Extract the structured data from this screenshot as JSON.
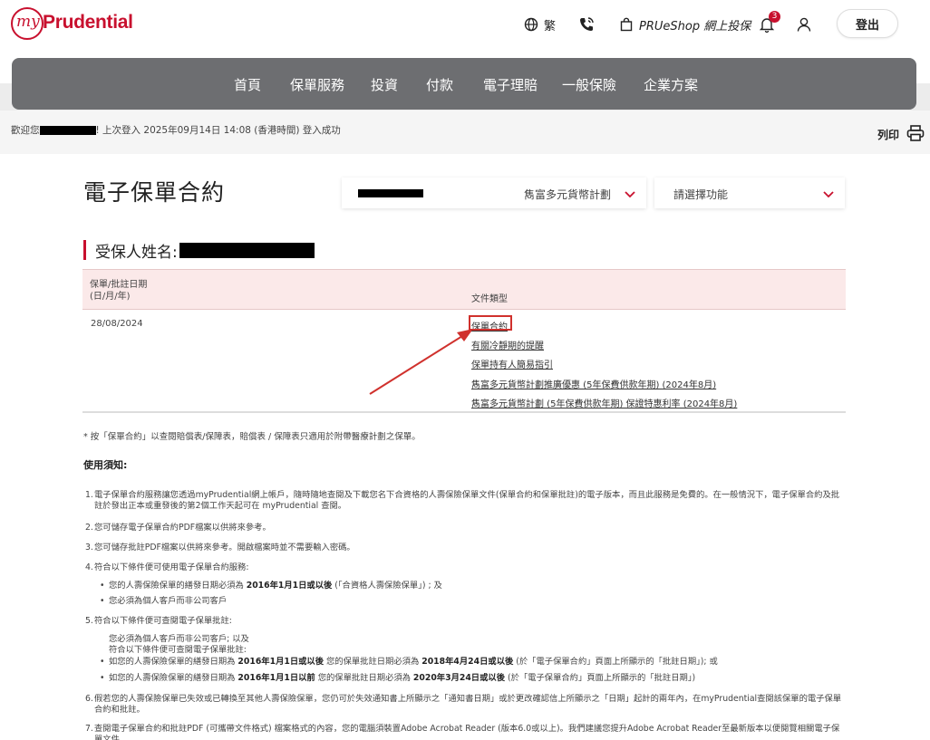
{
  "header": {
    "logo_my": "my",
    "logo_brand": "Prudential",
    "lang_label": "繁",
    "shop_label": "PRUeShop 網上投保",
    "notification_count": "3",
    "logout_label": "登出"
  },
  "nav": {
    "items": [
      "首頁",
      "保單服務",
      "投資",
      "付款",
      "電子理賠",
      "一般保險",
      "企業方案"
    ]
  },
  "welcome": {
    "prefix": "歡迎您",
    "suffix": "! 上次登入 2025年09月14日 14:08 (香港時間) 登入成功"
  },
  "print_label": "列印",
  "page": {
    "title": "電子保單合約",
    "policy_select_value": "雋富多元貨幣計劃",
    "function_select_placeholder": "請選擇功能",
    "insured_label": "受保人姓名:"
  },
  "table": {
    "col1_line1": "保單/批註日期",
    "col1_line2": "(日/月/年)",
    "col2": "文件類型",
    "row_date": "28/08/2024",
    "documents": [
      "保單合約",
      "有關冷靜期的提醒",
      "保單持有人簡易指引",
      "雋富多元貨幣計劃推廣優惠 (5年保費供款年期) (2024年8月)",
      "雋富多元貨幣計劃 (5年保費供款年期) 保證特惠利率 (2024年8月)"
    ]
  },
  "note": "* 按「保單合約」以查閱賠償表/保障表，賠償表 / 保障表只適用於附帶醫療計劃之保單。",
  "usage_title": "使用須知:",
  "terms": {
    "t1": "電子保單合約服務讓您透過myPrudential網上帳戶，隨時隨地查閱及下載您名下合資格的人壽保險保單文件(保單合約和保單批註)的電子版本，而且此服務是免費的。在一般情況下，電子保單合約及批註於發出正本或重發後的第2個工作天起可在 myPrudential 查閱。",
    "t2": "您可儲存電子保單合約PDF檔案以供將來參考。",
    "t3": "您可儲存批註PDF檔案以供將來參考。開啟檔案時並不需要輸入密碼。",
    "t4": "符合以下條件便可使用電子保單合約服務:",
    "t4a_pre": "您的人壽保險保單的繕發日期必須為 ",
    "t4a_bold": "2016年1月1日或以後",
    "t4a_post": " (「合資格人壽保險保單」) ; 及",
    "t4b": "您必須為個人客戶而非公司客戶",
    "t5": "符合以下條件便可查閱電子保單批註:",
    "t5_p1": "您必須為個人客戶而非公司客戶; 以及",
    "t5_p2": "符合以下條件便可查閱電子保單批註:",
    "t5a_pre": "如您的人壽保險保單的繕發日期為 ",
    "t5a_b1": "2016年1月1日或以後",
    "t5a_mid": " 您的保單批註日期必須為 ",
    "t5a_b2": "2018年4月24日或以後",
    "t5a_post": " (於「電子保單合約」頁面上所顯示的「批註日期」); 或",
    "t5b_pre": "如您的人壽保險保單的繕發日期為 ",
    "t5b_b1": "2016年1月1日以前",
    "t5b_mid": " 您的保單批註日期必須為 ",
    "t5b_b2": "2020年3月24日或以後",
    "t5b_post": " (於「電子保單合約」頁面上所顯示的「批註日期」)",
    "t6": "假若您的人壽保險保單已失效或已轉換至其他人壽保險保單，您仍可於失效通知書上所顯示之「通知書日期」或於更改確認信上所顯示之「日期」起計的兩年內，在myPrudential查閱該保單的電子保單合約和批註。",
    "t7": "查閱電子保單合約和批註PDF (可攜帶文件格式) 檔案格式的內容，您的電腦須裝置Adobe Acrobat Reader (版本6.0或以上)。我們建議您提升Adobe Acrobat Reader至最新版本以便閱覽相關電子保單文件。"
  },
  "colors": {
    "brand_red": "#c8102e",
    "nav_gray": "#6d6e71",
    "table_header_pink": "#fbe9e9"
  }
}
